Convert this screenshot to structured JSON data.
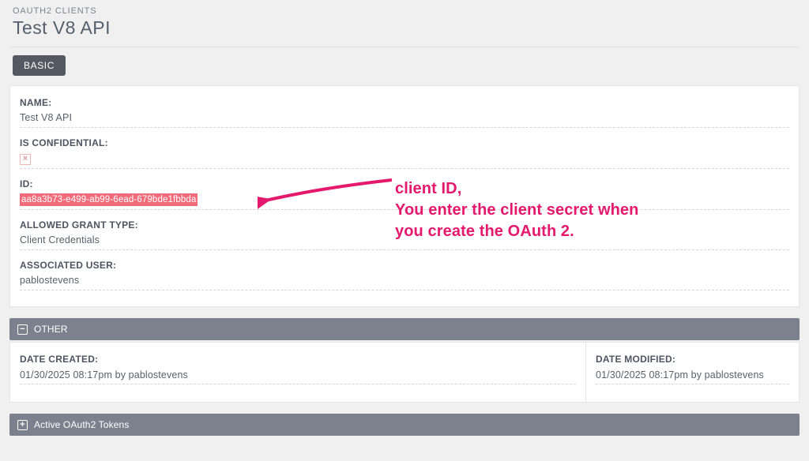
{
  "breadcrumb": "OAUTH2 CLIENTS",
  "page_title": "Test V8 API",
  "tab": {
    "basic": "BASIC"
  },
  "fields": {
    "name": {
      "label": "NAME:",
      "value": "Test V8 API"
    },
    "confidential": {
      "label": "IS CONFIDENTIAL:",
      "value": ""
    },
    "id": {
      "label": "ID:",
      "value": "aa8a3b73-e499-ab99-6ead-679bde1fbbda"
    },
    "grant": {
      "label": "ALLOWED GRANT TYPE:",
      "value": "Client Credentials"
    },
    "user": {
      "label": "ASSOCIATED USER:",
      "value": "pablostevens"
    }
  },
  "sections": {
    "other": "OTHER",
    "tokens": "Active OAuth2 Tokens"
  },
  "meta": {
    "created": {
      "label": "DATE CREATED:",
      "value": "01/30/2025 08:17pm by pablostevens"
    },
    "modified": {
      "label": "DATE MODIFIED:",
      "value": "01/30/2025 08:17pm by pablostevens"
    }
  },
  "annotation": {
    "line1": "client ID,",
    "line2": "You enter the client secret when",
    "line3": "you create the OAuth 2."
  }
}
